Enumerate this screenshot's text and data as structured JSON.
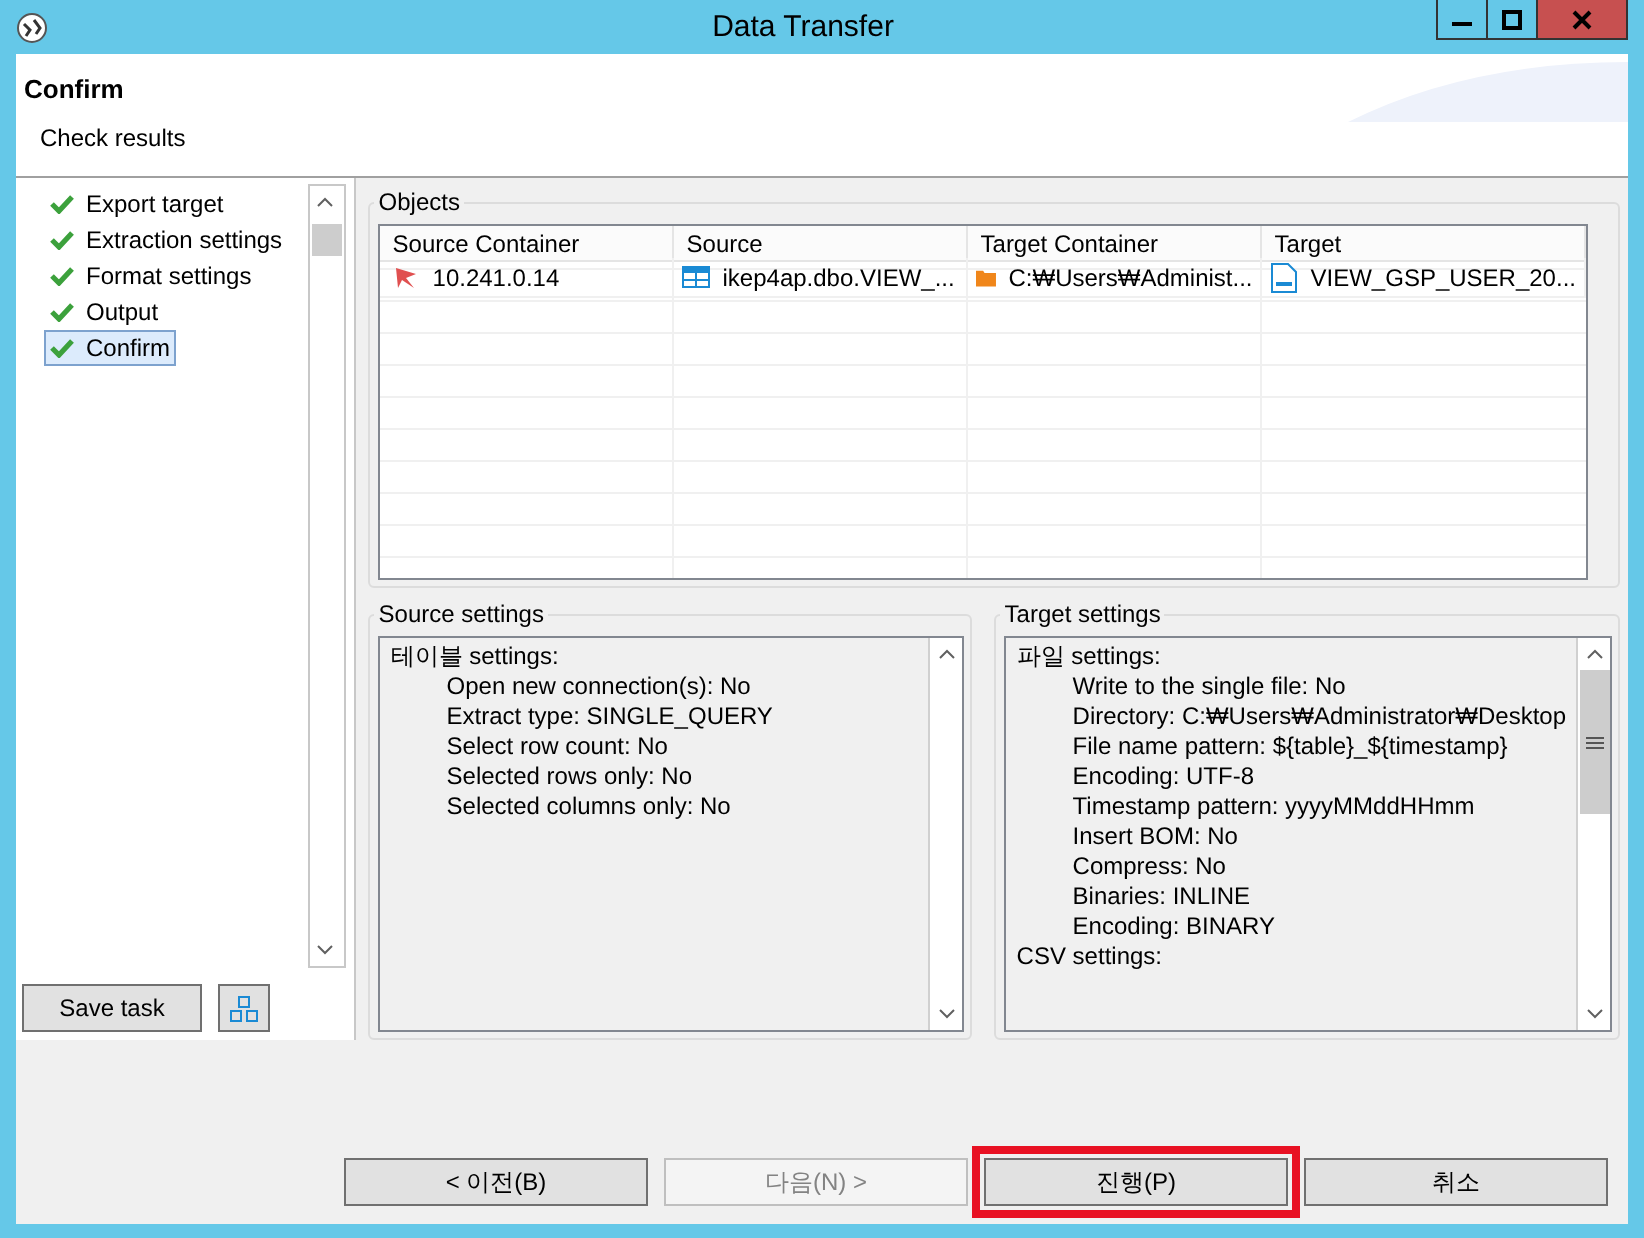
{
  "window": {
    "title": "Data Transfer"
  },
  "header": {
    "title": "Confirm",
    "subtitle": "Check results"
  },
  "steps": [
    {
      "label": "Export target",
      "selected": false
    },
    {
      "label": "Extraction settings",
      "selected": false
    },
    {
      "label": "Format settings",
      "selected": false
    },
    {
      "label": "Output",
      "selected": false
    },
    {
      "label": "Confirm",
      "selected": true
    }
  ],
  "save_task": "Save task",
  "objects": {
    "title": "Objects",
    "columns": [
      "Source Container",
      "Source",
      "Target Container",
      "Target"
    ],
    "rows": [
      [
        {
          "kind": "server",
          "text": "10.241.0.14"
        },
        {
          "kind": "table",
          "text": "ikep4ap.dbo.VIEW_..."
        },
        {
          "kind": "folder",
          "text": "C:₩Users₩Administ..."
        },
        {
          "kind": "csv",
          "text": "VIEW_GSP_USER_20..."
        }
      ]
    ]
  },
  "source_settings": {
    "title": "Source settings",
    "groups": [
      {
        "heading": "테이블 settings:",
        "items": [
          "Open new connection(s): No",
          "Extract type: SINGLE_QUERY",
          "Select row count: No",
          "Selected rows only: No",
          "Selected columns only: No"
        ]
      }
    ]
  },
  "target_settings": {
    "title": "Target settings",
    "groups": [
      {
        "heading": "파일 settings:",
        "items": [
          "Write to the single file: No",
          "Directory: C:₩Users₩Administrator₩Desktop",
          "File name pattern: ${table}_${timestamp}",
          "Encoding: UTF-8",
          "Timestamp pattern: yyyyMMddHHmm",
          "Insert BOM: No",
          "Compress: No",
          "Binaries: INLINE",
          "Encoding: BINARY"
        ]
      },
      {
        "heading": "CSV settings:"
      }
    ]
  },
  "buttons": [
    {
      "label": "< 이전(B)",
      "disabled": false,
      "highlighted": false
    },
    {
      "label": "다음(N) >",
      "disabled": true,
      "highlighted": false
    },
    {
      "label": "진행(P)",
      "disabled": false,
      "highlighted": true
    },
    {
      "label": "취소",
      "disabled": false,
      "highlighted": false
    }
  ]
}
